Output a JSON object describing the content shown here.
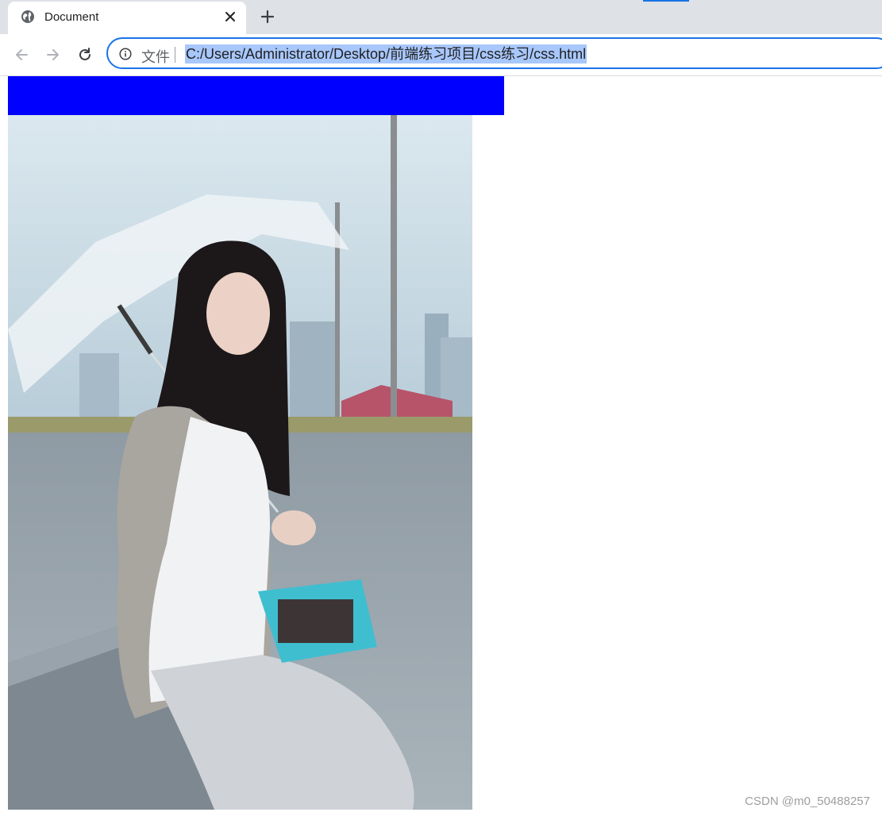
{
  "browser": {
    "tab": {
      "title": "Document",
      "favicon": "globe-icon"
    },
    "new_tab_icon": "plus-icon",
    "nav": {
      "back_icon": "back-arrow-icon",
      "forward_icon": "forward-arrow-icon",
      "reload_icon": "reload-icon"
    },
    "omnibox": {
      "scheme_label": "文件",
      "url": "C:/Users/Administrator/Desktop/前端练习项目/css练习/css.html",
      "selection_color": "#a8c7fa",
      "focus_color": "#1a73e8"
    }
  },
  "page": {
    "blue_box_color": "#0000ff",
    "photo": {
      "alt": "woman with umbrella on rooftop"
    }
  },
  "watermark": "CSDN @m0_50488257"
}
